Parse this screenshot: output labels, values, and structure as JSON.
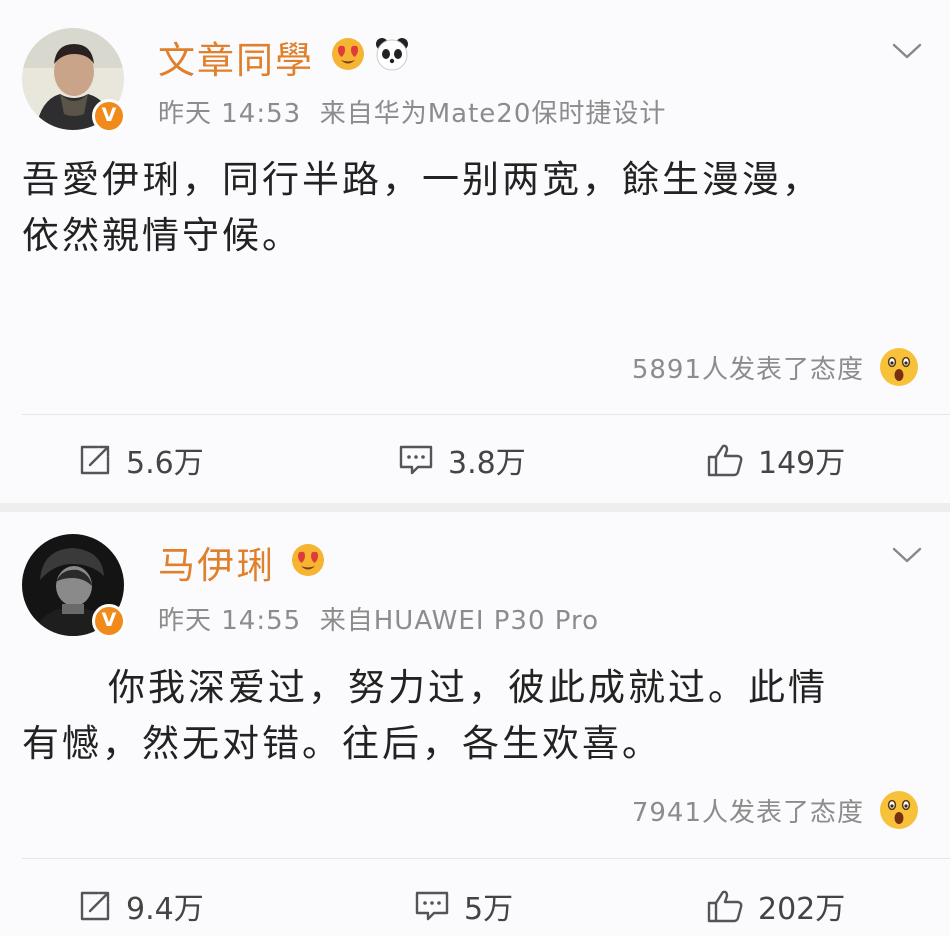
{
  "posts": [
    {
      "username": "文章同學",
      "time": "昨天 14:53",
      "source": "来自华为Mate20保时捷设计",
      "content_lines": [
        "吾愛伊琍，同行半路，一别两宽，餘生漫漫，",
        "依然親情守候。"
      ],
      "reaction_text": "5891人发表了态度",
      "repost_count": "5.6万",
      "comment_count": "3.8万",
      "like_count": "149万",
      "badge": "V",
      "emojis": [
        "heart-eyes-emoji-icon",
        "panda-emoji-icon"
      ]
    },
    {
      "username": "马伊琍",
      "time": "昨天 14:55",
      "source": "来自HUAWEI P30 Pro",
      "content_lines": [
        "你我深爱过，努力过，彼此成就过。此情",
        "有憾，然无对错。往后，各生欢喜。"
      ],
      "reaction_text": "7941人发表了态度",
      "repost_count": "9.4万",
      "comment_count": "5万",
      "like_count": "202万",
      "badge": "V",
      "emojis": [
        "heart-eyes-emoji-icon"
      ]
    }
  ],
  "icons": {
    "repost": "repost-icon",
    "comment": "comment-icon",
    "like": "thumbs-up-icon",
    "menu": "chevron-down-icon",
    "reaction": "surprised-face-icon",
    "verified": "verified-v-badge-icon"
  },
  "colors": {
    "username": "#e0802c",
    "meta": "#8c8c8c",
    "text": "#222222",
    "badge": "#f08a1a",
    "background": "#fbfbfd",
    "separator": "#eeeeef"
  }
}
